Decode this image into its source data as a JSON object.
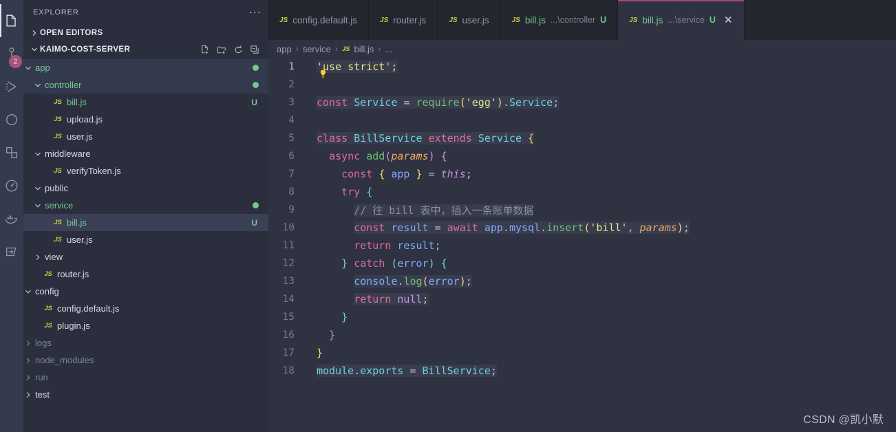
{
  "activity_bar": {
    "items": [
      {
        "name": "explorer-icon",
        "label": "Explorer",
        "active": true,
        "badge": ""
      },
      {
        "name": "source-control-icon",
        "label": "Source Control",
        "active": false,
        "badge": "2"
      },
      {
        "name": "run-debug-icon",
        "label": "Run and Debug",
        "active": false,
        "badge": ""
      },
      {
        "name": "search-icon",
        "label": "Search",
        "active": false,
        "badge": ""
      },
      {
        "name": "extensions-icon",
        "label": "Extensions",
        "active": false,
        "badge": ""
      },
      {
        "name": "testing-icon",
        "label": "Testing",
        "active": false,
        "badge": ""
      },
      {
        "name": "docker-icon",
        "label": "Docker",
        "active": false,
        "badge": ""
      },
      {
        "name": "remote-explorer-icon",
        "label": "Remote Explorer",
        "active": false,
        "badge": ""
      }
    ],
    "badge_color": "#f06292"
  },
  "sidebar": {
    "title": "EXPLORER",
    "overflow_label": "...",
    "open_editors": {
      "label": "OPEN EDITORS",
      "expanded": false
    },
    "workspace": {
      "label": "KAIMO-COST-SERVER",
      "expanded": true,
      "actions": [
        "new-file-icon",
        "new-folder-icon",
        "refresh-icon",
        "collapse-all-icon"
      ]
    },
    "tree": [
      {
        "label": "app",
        "type": "folder",
        "indent": 0,
        "expanded": true,
        "color": "green",
        "dot": true,
        "badge": "",
        "state": "hl"
      },
      {
        "label": "controller",
        "type": "folder",
        "indent": 1,
        "expanded": true,
        "color": "green",
        "dot": true,
        "badge": "",
        "state": "hl"
      },
      {
        "label": "bill.js",
        "type": "file",
        "indent": 2,
        "expanded": null,
        "color": "green",
        "dot": false,
        "badge": "U",
        "state": ""
      },
      {
        "label": "upload.js",
        "type": "file",
        "indent": 2,
        "expanded": null,
        "color": "white",
        "dot": false,
        "badge": "",
        "state": ""
      },
      {
        "label": "user.js",
        "type": "file",
        "indent": 2,
        "expanded": null,
        "color": "white",
        "dot": false,
        "badge": "",
        "state": ""
      },
      {
        "label": "middleware",
        "type": "folder",
        "indent": 1,
        "expanded": true,
        "color": "white",
        "dot": false,
        "badge": "",
        "state": ""
      },
      {
        "label": "verifyToken.js",
        "type": "file",
        "indent": 2,
        "expanded": null,
        "color": "white",
        "dot": false,
        "badge": "",
        "state": ""
      },
      {
        "label": "public",
        "type": "folder",
        "indent": 1,
        "expanded": true,
        "color": "white",
        "dot": false,
        "badge": "",
        "state": ""
      },
      {
        "label": "service",
        "type": "folder",
        "indent": 1,
        "expanded": true,
        "color": "green",
        "dot": true,
        "badge": "",
        "state": ""
      },
      {
        "label": "bill.js",
        "type": "file",
        "indent": 2,
        "expanded": null,
        "color": "green",
        "dot": false,
        "badge": "U",
        "state": "sel"
      },
      {
        "label": "user.js",
        "type": "file",
        "indent": 2,
        "expanded": null,
        "color": "white",
        "dot": false,
        "badge": "",
        "state": ""
      },
      {
        "label": "view",
        "type": "folder",
        "indent": 1,
        "expanded": false,
        "color": "white",
        "dot": false,
        "badge": "",
        "state": ""
      },
      {
        "label": "router.js",
        "type": "file",
        "indent": 1,
        "expanded": null,
        "color": "white",
        "dot": false,
        "badge": "",
        "state": ""
      },
      {
        "label": "config",
        "type": "folder",
        "indent": 0,
        "expanded": true,
        "color": "white",
        "dot": false,
        "badge": "",
        "state": ""
      },
      {
        "label": "config.default.js",
        "type": "file",
        "indent": 1,
        "expanded": null,
        "color": "white",
        "dot": false,
        "badge": "",
        "state": ""
      },
      {
        "label": "plugin.js",
        "type": "file",
        "indent": 1,
        "expanded": null,
        "color": "white",
        "dot": false,
        "badge": "",
        "state": ""
      },
      {
        "label": "logs",
        "type": "folder",
        "indent": 0,
        "expanded": false,
        "color": "dim",
        "dot": false,
        "badge": "",
        "state": ""
      },
      {
        "label": "node_modules",
        "type": "folder",
        "indent": 0,
        "expanded": false,
        "color": "dim",
        "dot": false,
        "badge": "",
        "state": ""
      },
      {
        "label": "run",
        "type": "folder",
        "indent": 0,
        "expanded": false,
        "color": "dim",
        "dot": false,
        "badge": "",
        "state": ""
      },
      {
        "label": "test",
        "type": "folder",
        "indent": 0,
        "expanded": false,
        "color": "white",
        "dot": false,
        "badge": "",
        "state": ""
      }
    ]
  },
  "tabs": [
    {
      "name": "config.default.js",
      "dir": "",
      "badge": "",
      "active": false,
      "modified": false,
      "close": false
    },
    {
      "name": "router.js",
      "dir": "",
      "badge": "",
      "active": false,
      "modified": false,
      "close": false
    },
    {
      "name": "user.js",
      "dir": "",
      "badge": "",
      "active": false,
      "modified": false,
      "close": false
    },
    {
      "name": "bill.js",
      "dir": "...\\controller",
      "badge": "U",
      "active": false,
      "modified": true,
      "close": false
    },
    {
      "name": "bill.js",
      "dir": "...\\service",
      "badge": "U",
      "active": true,
      "modified": true,
      "close": true
    }
  ],
  "tab_close_glyph": "✕",
  "breadcrumb": {
    "parts": [
      "app",
      "service",
      "bill.js",
      "..."
    ],
    "separator": "›"
  },
  "editor": {
    "active_line": 1,
    "lightbulb_line": 2,
    "lines": [
      {
        "n": "1",
        "tokens": [
          {
            "t": "'use strict';",
            "c": "str",
            "seg": true
          }
        ]
      },
      {
        "n": "2",
        "tokens": []
      },
      {
        "n": "3",
        "tokens": [
          {
            "t": "const",
            "c": "kw",
            "seg": true
          },
          {
            "t": " ",
            "c": "id",
            "seg": true
          },
          {
            "t": "Service",
            "c": "type",
            "seg": true
          },
          {
            "t": " ",
            "c": "id",
            "seg": true
          },
          {
            "t": "=",
            "c": "punct",
            "seg": true
          },
          {
            "t": " ",
            "c": "id",
            "seg": true
          },
          {
            "t": "require",
            "c": "fn",
            "seg": true
          },
          {
            "t": "(",
            "c": "br-y",
            "seg": true
          },
          {
            "t": "'egg'",
            "c": "str",
            "seg": true
          },
          {
            "t": ")",
            "c": "br-y",
            "seg": true
          },
          {
            "t": ".",
            "c": "dotm",
            "seg": true
          },
          {
            "t": "Service",
            "c": "type",
            "seg": true
          },
          {
            "t": ";",
            "c": "punct",
            "seg": true
          }
        ]
      },
      {
        "n": "4",
        "tokens": []
      },
      {
        "n": "5",
        "tokens": [
          {
            "t": "class",
            "c": "kw",
            "seg": true
          },
          {
            "t": " ",
            "c": "id",
            "seg": true
          },
          {
            "t": "BillService",
            "c": "type",
            "seg": true
          },
          {
            "t": " ",
            "c": "id",
            "seg": true
          },
          {
            "t": "extends",
            "c": "kw",
            "seg": true
          },
          {
            "t": " ",
            "c": "id",
            "seg": true
          },
          {
            "t": "Service",
            "c": "type",
            "seg": true
          },
          {
            "t": " ",
            "c": "id",
            "seg": true
          },
          {
            "t": "{",
            "c": "br-y",
            "seg": true
          }
        ]
      },
      {
        "n": "6",
        "tokens": [
          {
            "t": "  ",
            "c": "id",
            "seg": false
          },
          {
            "t": "async",
            "c": "kw",
            "seg": false
          },
          {
            "t": " ",
            "c": "id",
            "seg": false
          },
          {
            "t": "add",
            "c": "fn",
            "seg": false
          },
          {
            "t": "(",
            "c": "br-m",
            "seg": false
          },
          {
            "t": "params",
            "c": "param",
            "seg": false
          },
          {
            "t": ")",
            "c": "br-m",
            "seg": false
          },
          {
            "t": " ",
            "c": "id",
            "seg": false
          },
          {
            "t": "{",
            "c": "br-m",
            "seg": false
          }
        ]
      },
      {
        "n": "7",
        "tokens": [
          {
            "t": "    ",
            "c": "id",
            "seg": false
          },
          {
            "t": "const",
            "c": "kw",
            "seg": false
          },
          {
            "t": " ",
            "c": "id",
            "seg": false
          },
          {
            "t": "{",
            "c": "br-y",
            "seg": false
          },
          {
            "t": " ",
            "c": "id",
            "seg": false
          },
          {
            "t": "app",
            "c": "var",
            "seg": false
          },
          {
            "t": " ",
            "c": "id",
            "seg": false
          },
          {
            "t": "}",
            "c": "br-y",
            "seg": false
          },
          {
            "t": " ",
            "c": "id",
            "seg": false
          },
          {
            "t": "=",
            "c": "punct",
            "seg": false
          },
          {
            "t": " ",
            "c": "id",
            "seg": false
          },
          {
            "t": "this",
            "c": "this",
            "seg": false
          },
          {
            "t": ";",
            "c": "punct",
            "seg": false
          }
        ]
      },
      {
        "n": "8",
        "tokens": [
          {
            "t": "    ",
            "c": "id",
            "seg": false
          },
          {
            "t": "try",
            "c": "kw",
            "seg": false
          },
          {
            "t": " ",
            "c": "id",
            "seg": false
          },
          {
            "t": "{",
            "c": "br-b",
            "seg": false
          }
        ]
      },
      {
        "n": "9",
        "tokens": [
          {
            "t": "      ",
            "c": "id",
            "seg": false
          },
          {
            "t": "// 往 bill 表中，插入一条账单数据",
            "c": "cmt",
            "seg": true
          }
        ]
      },
      {
        "n": "10",
        "tokens": [
          {
            "t": "      ",
            "c": "id",
            "seg": false
          },
          {
            "t": "const",
            "c": "kw",
            "seg": true
          },
          {
            "t": " ",
            "c": "id",
            "seg": true
          },
          {
            "t": "result",
            "c": "var",
            "seg": true
          },
          {
            "t": " ",
            "c": "id",
            "seg": true
          },
          {
            "t": "=",
            "c": "punct",
            "seg": true
          },
          {
            "t": " ",
            "c": "id",
            "seg": true
          },
          {
            "t": "await",
            "c": "kw",
            "seg": true
          },
          {
            "t": " ",
            "c": "id",
            "seg": true
          },
          {
            "t": "app",
            "c": "var",
            "seg": true
          },
          {
            "t": ".",
            "c": "dotm",
            "seg": true
          },
          {
            "t": "mysql",
            "c": "var",
            "seg": true
          },
          {
            "t": ".",
            "c": "dotm",
            "seg": true
          },
          {
            "t": "insert",
            "c": "fn",
            "seg": true
          },
          {
            "t": "(",
            "c": "br-y",
            "seg": true
          },
          {
            "t": "'bill'",
            "c": "str",
            "seg": true
          },
          {
            "t": ",",
            "c": "punct",
            "seg": true
          },
          {
            "t": " ",
            "c": "id",
            "seg": true
          },
          {
            "t": "params",
            "c": "param",
            "seg": true
          },
          {
            "t": ")",
            "c": "br-y",
            "seg": true
          },
          {
            "t": ";",
            "c": "punct",
            "seg": true
          }
        ]
      },
      {
        "n": "11",
        "tokens": [
          {
            "t": "      ",
            "c": "id",
            "seg": false
          },
          {
            "t": "return",
            "c": "kw",
            "seg": false
          },
          {
            "t": " ",
            "c": "id",
            "seg": false
          },
          {
            "t": "result",
            "c": "var",
            "seg": false
          },
          {
            "t": ";",
            "c": "punct",
            "seg": false
          }
        ]
      },
      {
        "n": "12",
        "tokens": [
          {
            "t": "    ",
            "c": "id",
            "seg": false
          },
          {
            "t": "}",
            "c": "br-b",
            "seg": false
          },
          {
            "t": " ",
            "c": "id",
            "seg": false
          },
          {
            "t": "catch",
            "c": "kw",
            "seg": false
          },
          {
            "t": " ",
            "c": "id",
            "seg": false
          },
          {
            "t": "(",
            "c": "br-b",
            "seg": false
          },
          {
            "t": "error",
            "c": "var",
            "seg": false
          },
          {
            "t": ")",
            "c": "br-b",
            "seg": false
          },
          {
            "t": " ",
            "c": "id",
            "seg": false
          },
          {
            "t": "{",
            "c": "br-b",
            "seg": false
          }
        ]
      },
      {
        "n": "13",
        "tokens": [
          {
            "t": "      ",
            "c": "id",
            "seg": false
          },
          {
            "t": "console",
            "c": "var",
            "seg": true
          },
          {
            "t": ".",
            "c": "dotm",
            "seg": true
          },
          {
            "t": "log",
            "c": "fn",
            "seg": true
          },
          {
            "t": "(",
            "c": "br-y",
            "seg": true
          },
          {
            "t": "error",
            "c": "var",
            "seg": true
          },
          {
            "t": ")",
            "c": "br-y",
            "seg": true
          },
          {
            "t": ";",
            "c": "punct",
            "seg": true
          }
        ]
      },
      {
        "n": "14",
        "tokens": [
          {
            "t": "      ",
            "c": "id",
            "seg": false
          },
          {
            "t": "return",
            "c": "kw",
            "seg": true
          },
          {
            "t": " ",
            "c": "id",
            "seg": true
          },
          {
            "t": "null",
            "c": "kw2",
            "seg": true
          },
          {
            "t": ";",
            "c": "punct",
            "seg": true
          }
        ]
      },
      {
        "n": "15",
        "tokens": [
          {
            "t": "    ",
            "c": "id",
            "seg": false
          },
          {
            "t": "}",
            "c": "br-b",
            "seg": false
          }
        ]
      },
      {
        "n": "16",
        "tokens": [
          {
            "t": "  ",
            "c": "id",
            "seg": false
          },
          {
            "t": "}",
            "c": "br-m",
            "seg": false
          }
        ]
      },
      {
        "n": "17",
        "tokens": [
          {
            "t": "}",
            "c": "br-y",
            "seg": false
          }
        ]
      },
      {
        "n": "18",
        "tokens": [
          {
            "t": "module",
            "c": "type",
            "seg": true
          },
          {
            "t": ".",
            "c": "dotm",
            "seg": true
          },
          {
            "t": "exports",
            "c": "type",
            "seg": true
          },
          {
            "t": " ",
            "c": "id",
            "seg": true
          },
          {
            "t": "=",
            "c": "punct",
            "seg": true
          },
          {
            "t": " ",
            "c": "id",
            "seg": true
          },
          {
            "t": "BillService",
            "c": "type",
            "seg": true
          },
          {
            "t": ";",
            "c": "punct",
            "seg": true
          }
        ]
      }
    ]
  },
  "watermark": "CSDN @凯小默"
}
